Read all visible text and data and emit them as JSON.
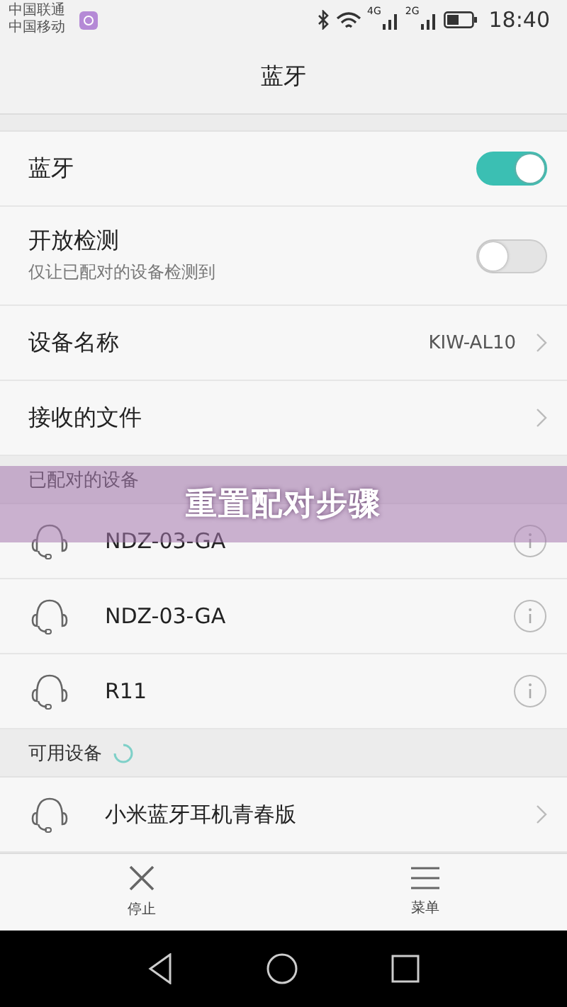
{
  "status_bar": {
    "carriers": [
      "中国联通",
      "中国移动"
    ],
    "network_labels": [
      "4G",
      "2G"
    ],
    "time": "18:40"
  },
  "title": "蓝牙",
  "settings": [
    {
      "kind": "toggle",
      "label": "蓝牙",
      "on": true
    },
    {
      "kind": "toggle",
      "label": "开放检测",
      "sublabel": "仅让已配对的设备检测到",
      "on": false
    },
    {
      "kind": "link",
      "label": "设备名称",
      "value": "KIW-AL10"
    },
    {
      "kind": "link",
      "label": "接收的文件"
    }
  ],
  "paired_header": "已配对的设备",
  "paired_devices": [
    {
      "name": "NDZ-03-GA"
    },
    {
      "name": "NDZ-03-GA"
    },
    {
      "name": "R11"
    }
  ],
  "available_header": "可用设备",
  "available_devices": [
    {
      "name": "小米蓝牙耳机青春版"
    }
  ],
  "bottom_actions": [
    {
      "kind": "stop",
      "label": "停止"
    },
    {
      "kind": "menu",
      "label": "菜单"
    }
  ],
  "overlay_banner": "重置配对步骤"
}
